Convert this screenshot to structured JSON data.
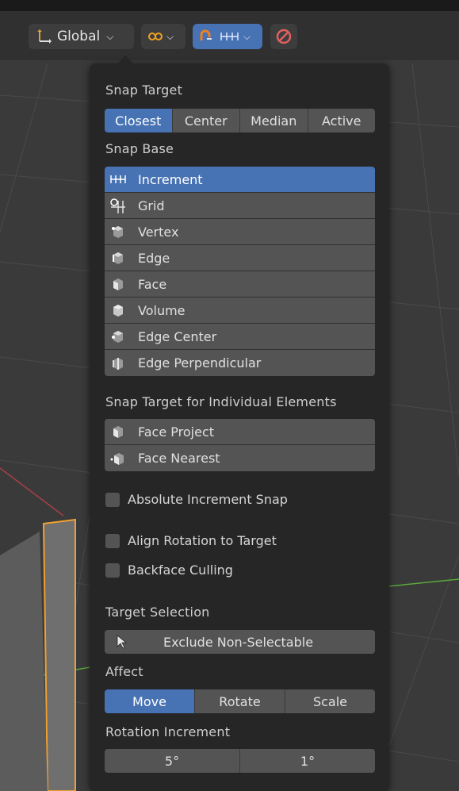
{
  "header": {
    "orientation_label": "Global",
    "colors": {
      "accent": "#4772b3",
      "header_bg": "#303030",
      "button_bg": "#3d3d3d"
    }
  },
  "popover": {
    "snap_target_label": "Snap Target",
    "snap_target_options": [
      "Closest",
      "Center",
      "Median",
      "Active"
    ],
    "snap_target_selected": "Closest",
    "snap_base_label": "Snap Base",
    "snap_base_items": [
      {
        "label": "Increment",
        "icon": "increment-icon",
        "active": true
      },
      {
        "label": "Grid",
        "icon": "grid-icon",
        "active": false
      },
      {
        "label": "Vertex",
        "icon": "vertex-icon",
        "active": false
      },
      {
        "label": "Edge",
        "icon": "edge-icon",
        "active": false
      },
      {
        "label": "Face",
        "icon": "face-icon",
        "active": false
      },
      {
        "label": "Volume",
        "icon": "volume-icon",
        "active": false
      },
      {
        "label": "Edge Center",
        "icon": "edge-center-icon",
        "active": false
      },
      {
        "label": "Edge Perpendicular",
        "icon": "edge-perpendicular-icon",
        "active": false
      }
    ],
    "individual_label": "Snap Target for Individual Elements",
    "individual_items": [
      {
        "label": "Face Project",
        "icon": "face-project-icon"
      },
      {
        "label": "Face Nearest",
        "icon": "face-nearest-icon"
      }
    ],
    "checkboxes": {
      "absolute_increment": "Absolute Increment Snap",
      "align_rotation": "Align Rotation to Target",
      "backface_culling": "Backface Culling"
    },
    "target_selection_label": "Target Selection",
    "target_selection_value": "Exclude Non-Selectable",
    "affect_label": "Affect",
    "affect_options": [
      "Move",
      "Rotate",
      "Scale"
    ],
    "affect_selected": "Move",
    "rotation_increment_label": "Rotation Increment",
    "rotation_increment_values": [
      "5°",
      "1°"
    ]
  }
}
